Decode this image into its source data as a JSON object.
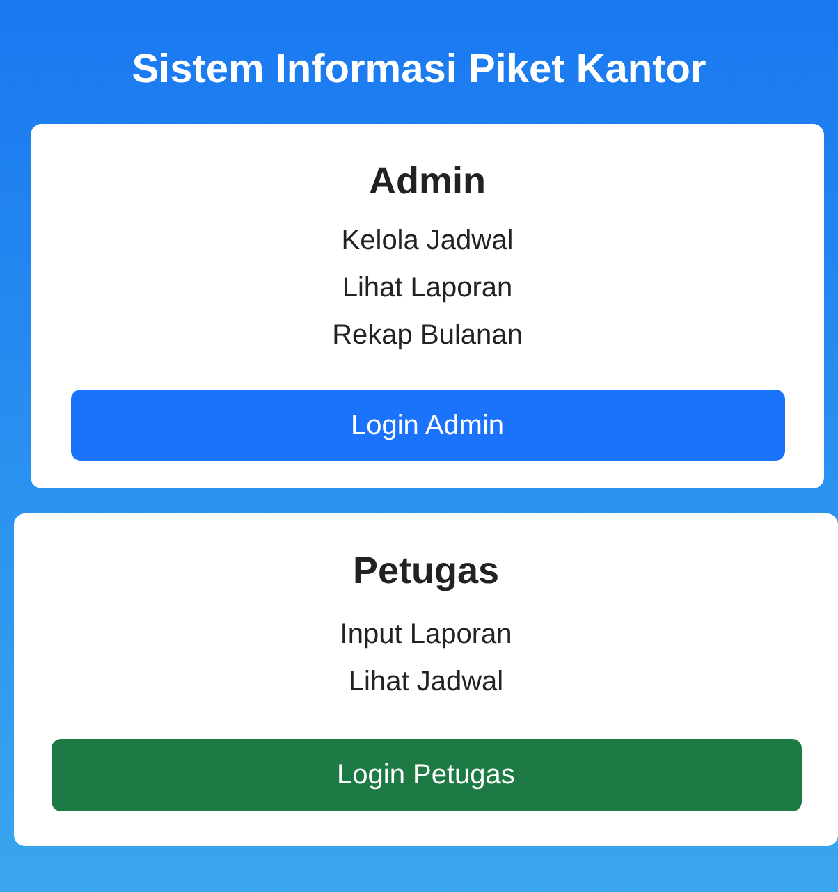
{
  "title": "Sistem Informasi Piket Kantor",
  "cards": [
    {
      "kind": "admin",
      "heading": "Admin",
      "items": [
        "Kelola Jadwal",
        "Lihat Laporan",
        "Rekap Bulanan"
      ],
      "button": "Login Admin"
    },
    {
      "kind": "petugas",
      "heading": "Petugas",
      "items": [
        "Input Laporan",
        "Lihat Jadwal"
      ],
      "button": "Login Petugas"
    }
  ]
}
